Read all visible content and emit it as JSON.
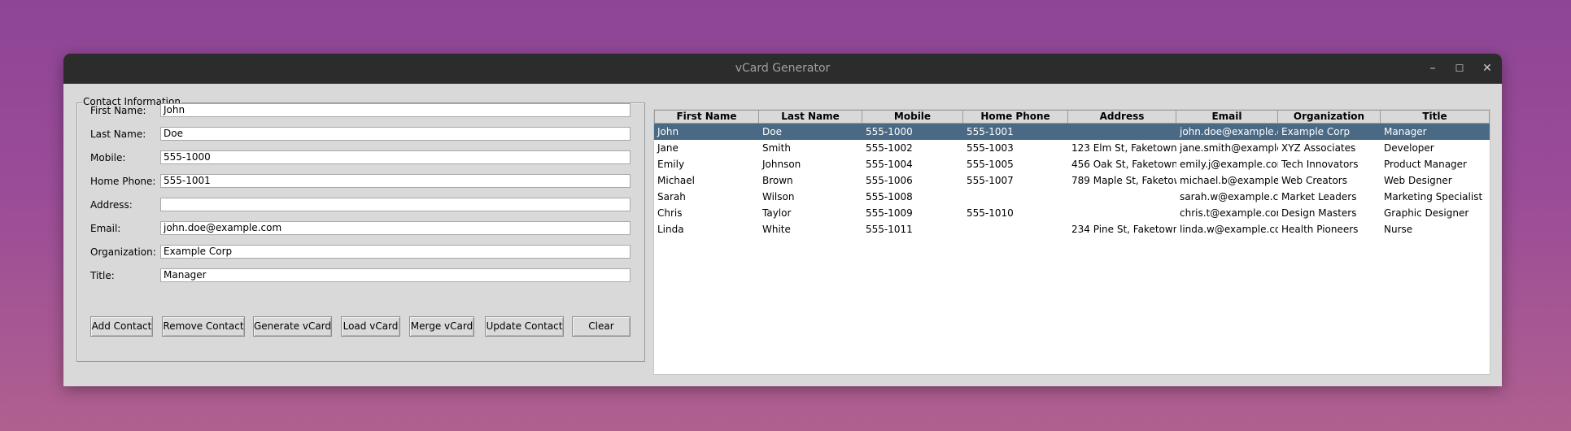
{
  "window": {
    "title": "vCard Generator",
    "controls": {
      "minimize": "–",
      "maximize": "☐",
      "close": "✕"
    }
  },
  "form": {
    "group_label": "Contact Information",
    "fields": [
      {
        "label": "First Name:",
        "value": "John"
      },
      {
        "label": "Last Name:",
        "value": "Doe"
      },
      {
        "label": "Mobile:",
        "value": "555-1000"
      },
      {
        "label": "Home Phone:",
        "value": "555-1001"
      },
      {
        "label": "Address:",
        "value": ""
      },
      {
        "label": "Email:",
        "value": "john.doe@example.com"
      },
      {
        "label": "Organization:",
        "value": "Example Corp"
      },
      {
        "label": "Title:",
        "value": "Manager"
      }
    ],
    "buttons": [
      "Add Contact",
      "Remove Contact",
      "Generate vCard",
      "Load vCard",
      "Merge vCard",
      "Update Contact",
      "Clear"
    ]
  },
  "table": {
    "columns": [
      "First Name",
      "Last Name",
      "Mobile",
      "Home Phone",
      "Address",
      "Email",
      "Organization",
      "Title"
    ],
    "selected_row": 0,
    "rows": [
      [
        "John",
        "Doe",
        "555-1000",
        "555-1001",
        "",
        "john.doe@example.c",
        "Example Corp",
        "Manager"
      ],
      [
        "Jane",
        "Smith",
        "555-1002",
        "555-1003",
        "123 Elm St, Faketown,",
        "jane.smith@example.",
        "XYZ Associates",
        "Developer"
      ],
      [
        "Emily",
        "Johnson",
        "555-1004",
        "555-1005",
        "456 Oak St, Faketown,",
        "emily.j@example.com",
        "Tech Innovators",
        "Product Manager"
      ],
      [
        "Michael",
        "Brown",
        "555-1006",
        "555-1007",
        "789 Maple St, Faketow",
        "michael.b@example.c",
        "Web Creators",
        "Web Designer"
      ],
      [
        "Sarah",
        "Wilson",
        "555-1008",
        "",
        "",
        "sarah.w@example.co",
        "Market Leaders",
        "Marketing Specialist"
      ],
      [
        "Chris",
        "Taylor",
        "555-1009",
        "555-1010",
        "",
        "chris.t@example.com",
        "Design Masters",
        "Graphic Designer"
      ],
      [
        "Linda",
        "White",
        "555-1011",
        "",
        "234 Pine St, Faketown,",
        "linda.w@example.co",
        "Health Pioneers",
        "Nurse"
      ]
    ]
  },
  "scrollbar": {
    "left_arrow": "◀",
    "right_arrow": "▶"
  },
  "colors": {
    "selection": "#4a6984",
    "titlebar": "#2c2c2c",
    "window_bg": "#d9d9d9"
  }
}
